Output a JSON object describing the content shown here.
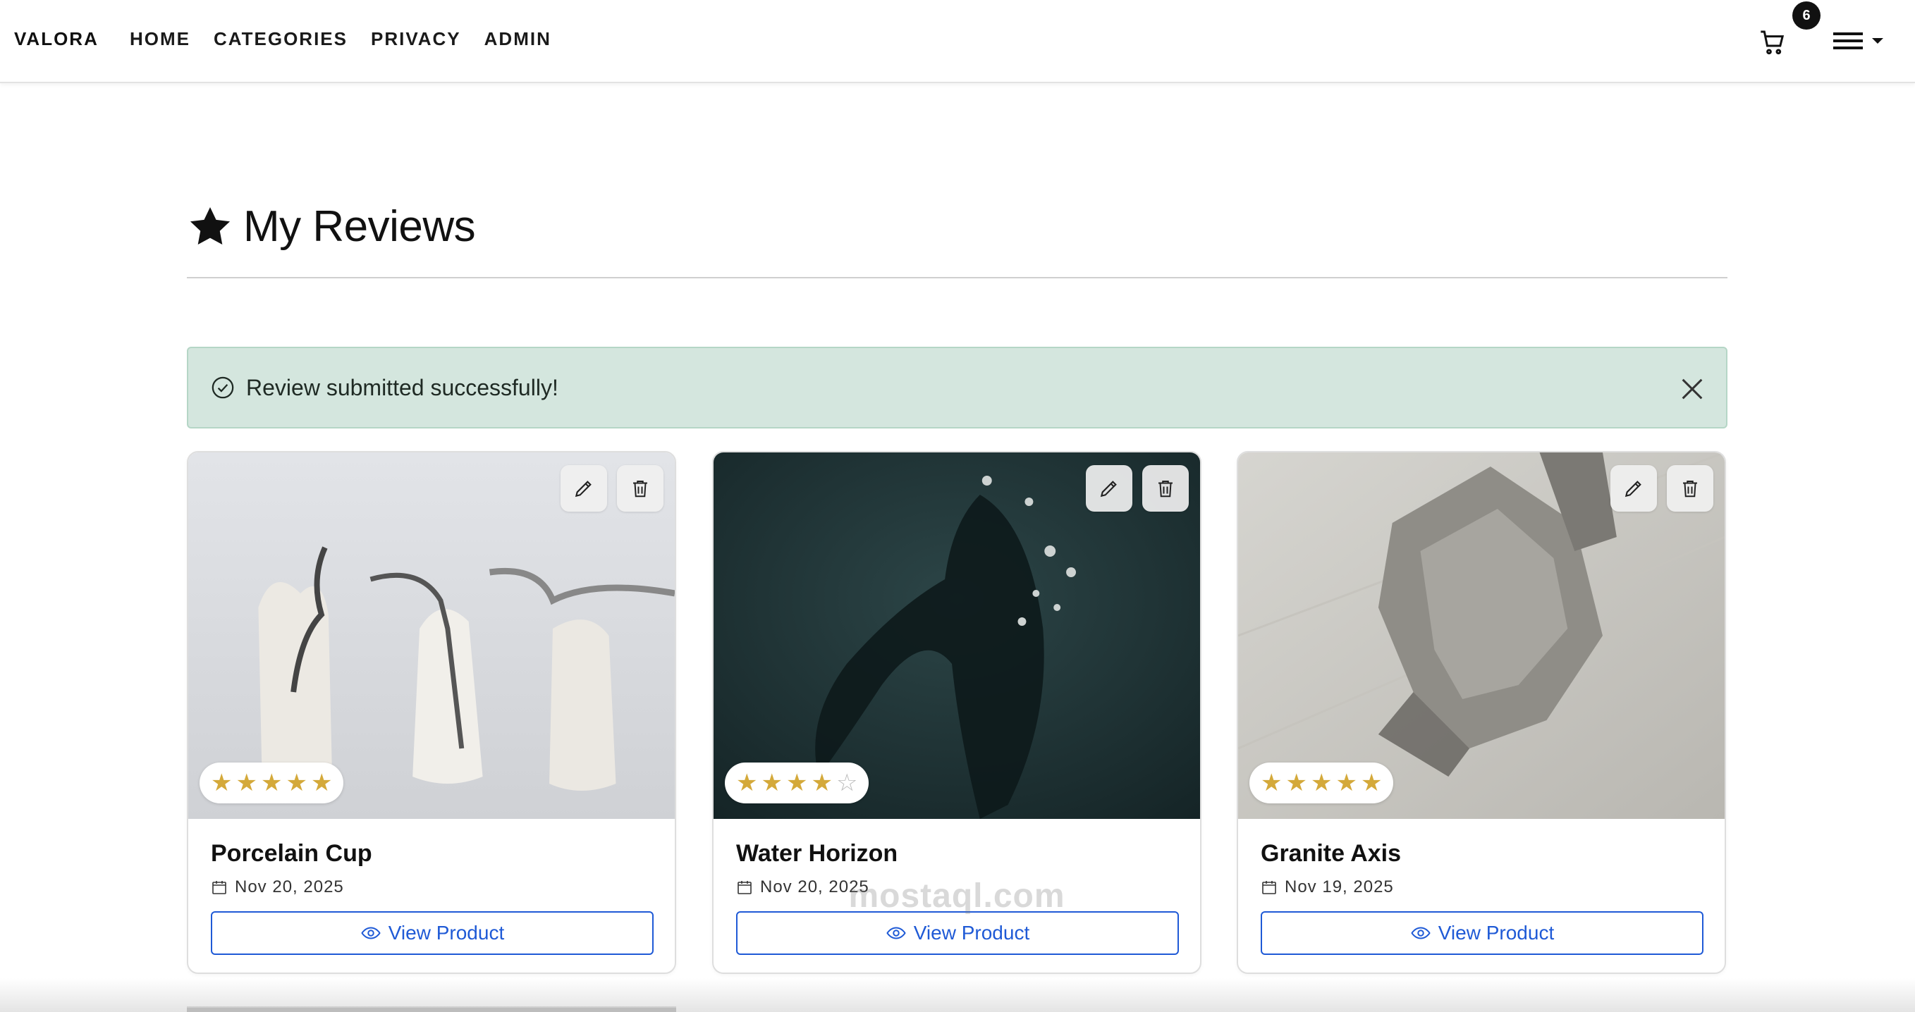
{
  "nav": {
    "brand": "VALORA",
    "links": [
      "HOME",
      "CATEGORIES",
      "PRIVACY",
      "ADMIN"
    ],
    "cart_count": "6"
  },
  "page": {
    "title": "My Reviews"
  },
  "alert": {
    "message": "Review submitted successfully!"
  },
  "reviews": [
    {
      "product": "Porcelain Cup",
      "date": "Nov 20, 2025",
      "rating": 5,
      "max_rating": 5,
      "button": "View Product"
    },
    {
      "product": "Water Horizon",
      "date": "Nov 20, 2025",
      "rating": 4,
      "max_rating": 5,
      "button": "View Product"
    },
    {
      "product": "Granite Axis",
      "date": "Nov 19, 2025",
      "rating": 5,
      "max_rating": 5,
      "button": "View Product"
    }
  ],
  "watermark": "mostaql.com",
  "colors": {
    "star": "#d4a93a",
    "primary": "#1f5ad6",
    "alert_bg": "#d4e6de"
  },
  "icons": {
    "header": "star-icon",
    "cart": "cart-icon",
    "menu": "hamburger-icon",
    "alert": "check-circle-icon",
    "close": "close-icon",
    "edit": "pencil-icon",
    "delete": "trash-icon",
    "date": "calendar-icon",
    "view": "eye-icon"
  }
}
